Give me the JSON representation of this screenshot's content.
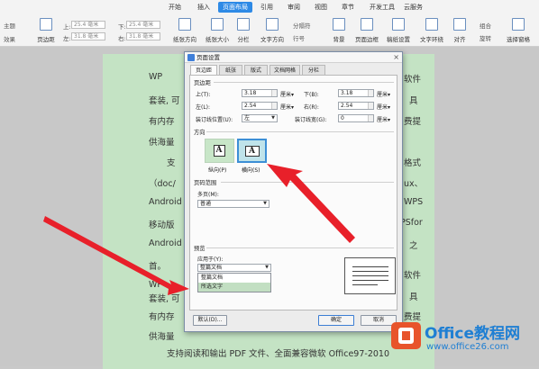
{
  "ribbon": {
    "tabs": [
      "开始",
      "插入",
      "页面布局",
      "引用",
      "审阅",
      "视图",
      "章节",
      "开发工具",
      "云服务"
    ],
    "active_tab": "页面布局",
    "left_stubs": [
      "主题",
      "效果"
    ],
    "margin_fields": {
      "top_label": "上:",
      "top_value": "25.4 毫米",
      "bottom_label": "下:",
      "bottom_value": "25.4 毫米",
      "left_label": "左:",
      "left_value": "31.8 毫米",
      "right_label": "右:",
      "right_value": "31.8 毫米"
    },
    "tools": {
      "margins": "页边距",
      "orientation": "纸张方向",
      "size": "纸张大小",
      "columns": "分栏",
      "text_dir": "文字方向",
      "breaks": "分隔符",
      "line_no": "行号",
      "background": "背景",
      "page_border": "页面边框",
      "paper_grid": "稿纸设置",
      "wrap": "文字环绕",
      "align": "对齐",
      "group": "组合",
      "rotate": "旋转",
      "select_pane": "选择窗格"
    }
  },
  "document": {
    "lines": [
      {
        "left": "WP",
        "right": "软件"
      },
      {
        "left": "套装, 可",
        "right": "具"
      },
      {
        "left": "有内存",
        "right": "费提"
      },
      {
        "left": "供海量",
        "right": ""
      },
      {
        "left": "支",
        "right": "格式"
      },
      {
        "left": "（doc/",
        "right": "ux、"
      },
      {
        "left": "Android",
        "right": "WPS"
      },
      {
        "left": "移动版",
        "right": "PSfor"
      },
      {
        "left": "Android",
        "right": "之"
      },
      {
        "left": "首。",
        "right": ""
      },
      {
        "left": "WP",
        "right": "软件"
      },
      {
        "left": "套装, 可",
        "right": "具"
      },
      {
        "left": "有内存",
        "right": "费提"
      },
      {
        "left": "供海量",
        "right": ""
      }
    ],
    "bottom_line": "支持阅读和输出 PDF 文件、全面兼容微软 Office97-2010"
  },
  "dialog": {
    "title": "页面设置",
    "close": "×",
    "tabs": [
      "页边距",
      "纸张",
      "版式",
      "文档网格",
      "分栏"
    ],
    "active_tab": "页边距",
    "margins_section": "页边距",
    "top_label": "上(T):",
    "top_value": "3.18",
    "top_unit": "厘米▾",
    "bottom_label": "下(B):",
    "bottom_value": "3.18",
    "bottom_unit": "厘米▾",
    "left_label": "左(L):",
    "left_value": "2.54",
    "left_unit": "厘米▾",
    "right_label": "右(R):",
    "right_value": "2.54",
    "right_unit": "厘米▾",
    "gutter_pos_label": "装订线位置(U):",
    "gutter_pos_value": "左",
    "gutter_width_label": "装订线宽(G):",
    "gutter_width_value": "0",
    "gutter_width_unit": "厘米▾",
    "orientation_section": "方向",
    "portrait_label": "纵向(P)",
    "landscape_label": "横向(S)",
    "orient_glyph": "A",
    "pages_section": "页码范围",
    "multi_label": "多页(M):",
    "multi_value": "普通",
    "preview_section": "预览",
    "apply_label": "应用于(Y):",
    "apply_value": "整篇文档",
    "apply_options": [
      "整篇文档",
      "所选文字"
    ],
    "highlighted_option": "所选文字",
    "default_button": "默认(D)...",
    "ok_button": "确定",
    "cancel_button": "取消"
  },
  "watermark": {
    "line1": "Office教程网",
    "line2": "www.office26.com"
  },
  "colors": {
    "arrow": "#e8202a",
    "page_bg": "#c4e3c4",
    "accent": "#2e8ae6",
    "logo": "#e8542b"
  }
}
